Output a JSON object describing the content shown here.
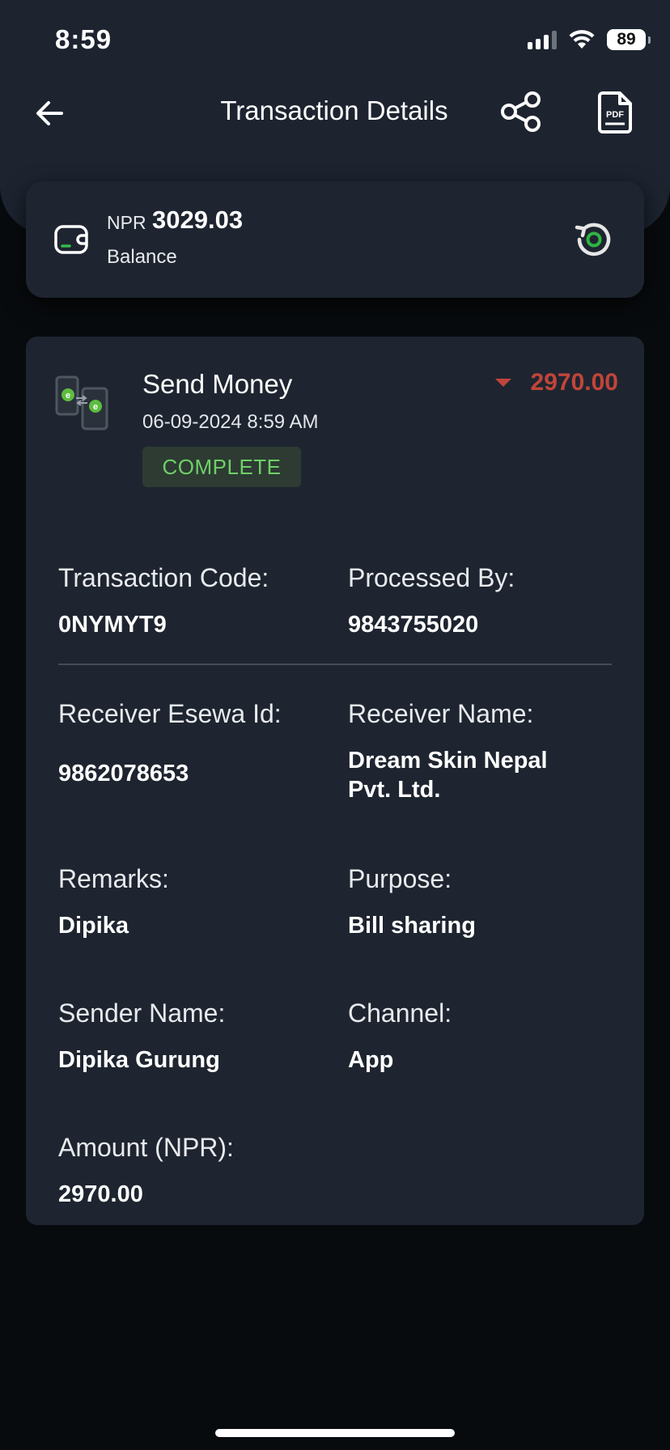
{
  "status_bar": {
    "time": "8:59",
    "battery": "89"
  },
  "nav": {
    "title": "Transaction Details"
  },
  "balance": {
    "currency": "NPR",
    "amount": "3029.03",
    "label": "Balance"
  },
  "transaction": {
    "type": "Send Money",
    "datetime": "06-09-2024 8:59 AM",
    "status": "COMPLETE",
    "amount": "2970.00",
    "direction": "debit",
    "amount_color": "#c0453a",
    "status_color": "#6fcf67"
  },
  "fields": {
    "transaction_code": {
      "label": "Transaction Code:",
      "value": "0NYMYT9"
    },
    "processed_by": {
      "label": "Processed By:",
      "value": "9843755020"
    },
    "receiver_id": {
      "label": "Receiver Esewa Id:",
      "value": "9862078653"
    },
    "receiver_name": {
      "label": "Receiver Name:",
      "value_line1": "Dream Skin Nepal",
      "value_line2": "Pvt. Ltd."
    },
    "remarks": {
      "label": "Remarks:",
      "value": "Dipika"
    },
    "purpose": {
      "label": "Purpose:",
      "value": "Bill sharing"
    },
    "sender_name": {
      "label": "Sender Name:",
      "value": "Dipika Gurung"
    },
    "channel": {
      "label": "Channel:",
      "value": "App"
    },
    "amount_npr": {
      "label": "Amount (NPR):",
      "value": "2970.00"
    }
  },
  "icons": [
    "back-arrow-icon",
    "share-icon",
    "pdf-icon",
    "wallet-icon",
    "refresh-icon",
    "send-money-icon"
  ]
}
